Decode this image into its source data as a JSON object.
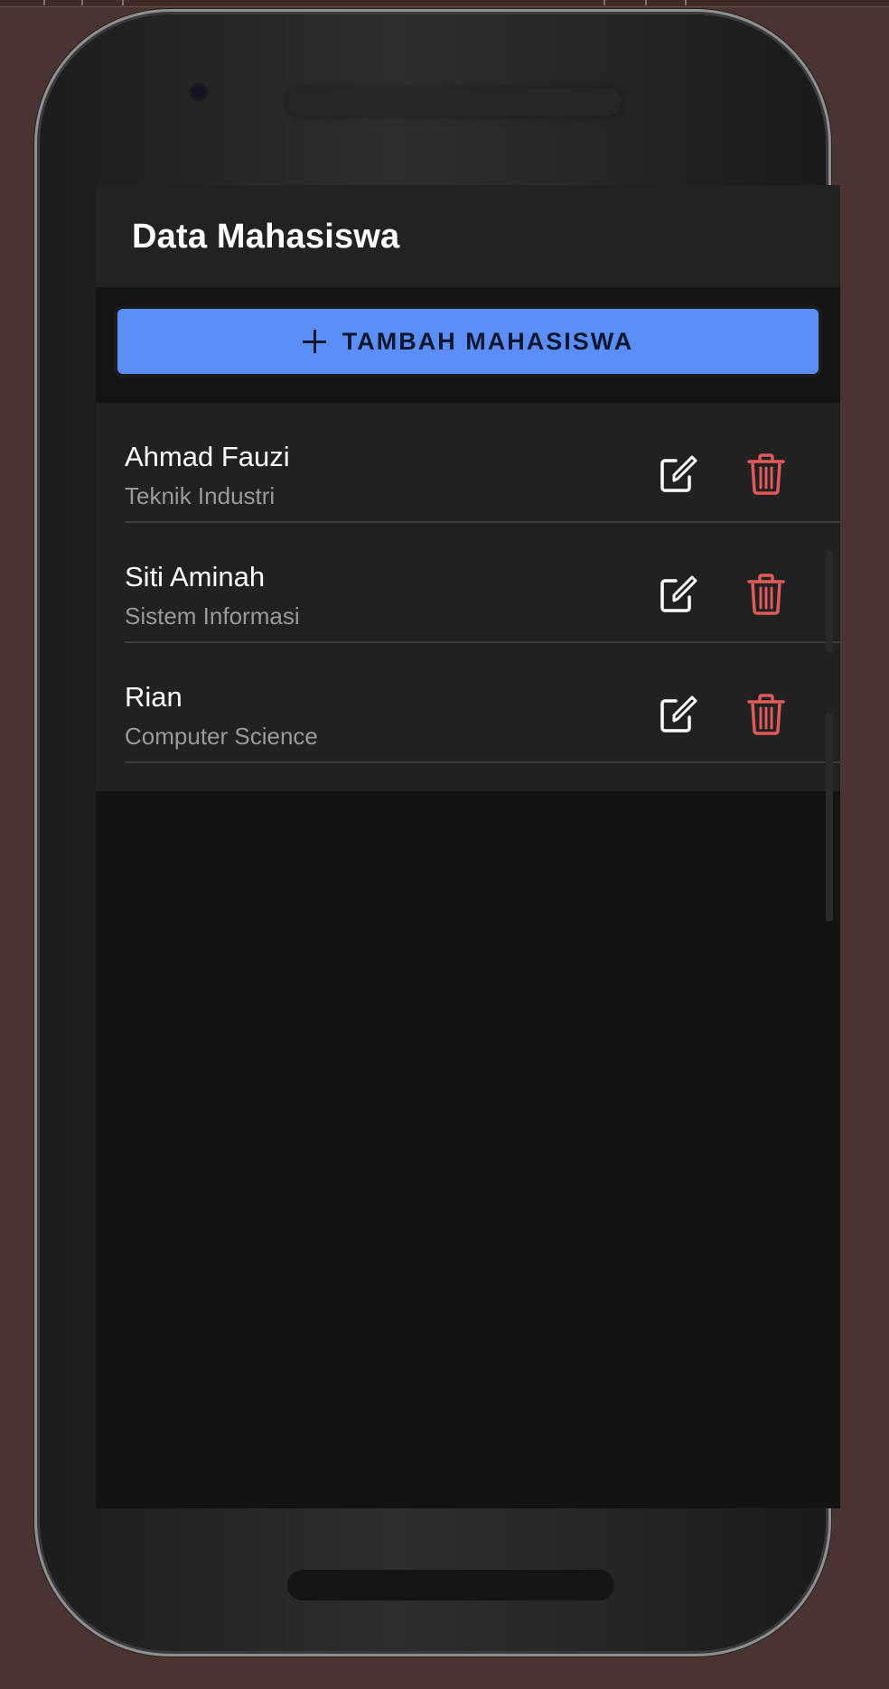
{
  "app": {
    "title": "Data Mahasiswa"
  },
  "add_button": {
    "label": "TAMBAH MAHASISWA",
    "icon": "plus-icon"
  },
  "students": [
    {
      "name": "Ahmad Fauzi",
      "major": "Teknik Industri"
    },
    {
      "name": "Siti Aminah",
      "major": "Sistem Informasi"
    },
    {
      "name": "Rian",
      "major": "Computer Science"
    }
  ],
  "row_actions": {
    "edit_icon": "edit-icon",
    "delete_icon": "trash-icon"
  },
  "colors": {
    "accent": "#5b8ef6",
    "delete": "#e05a5a",
    "surface": "#212121",
    "background": "#131313"
  }
}
